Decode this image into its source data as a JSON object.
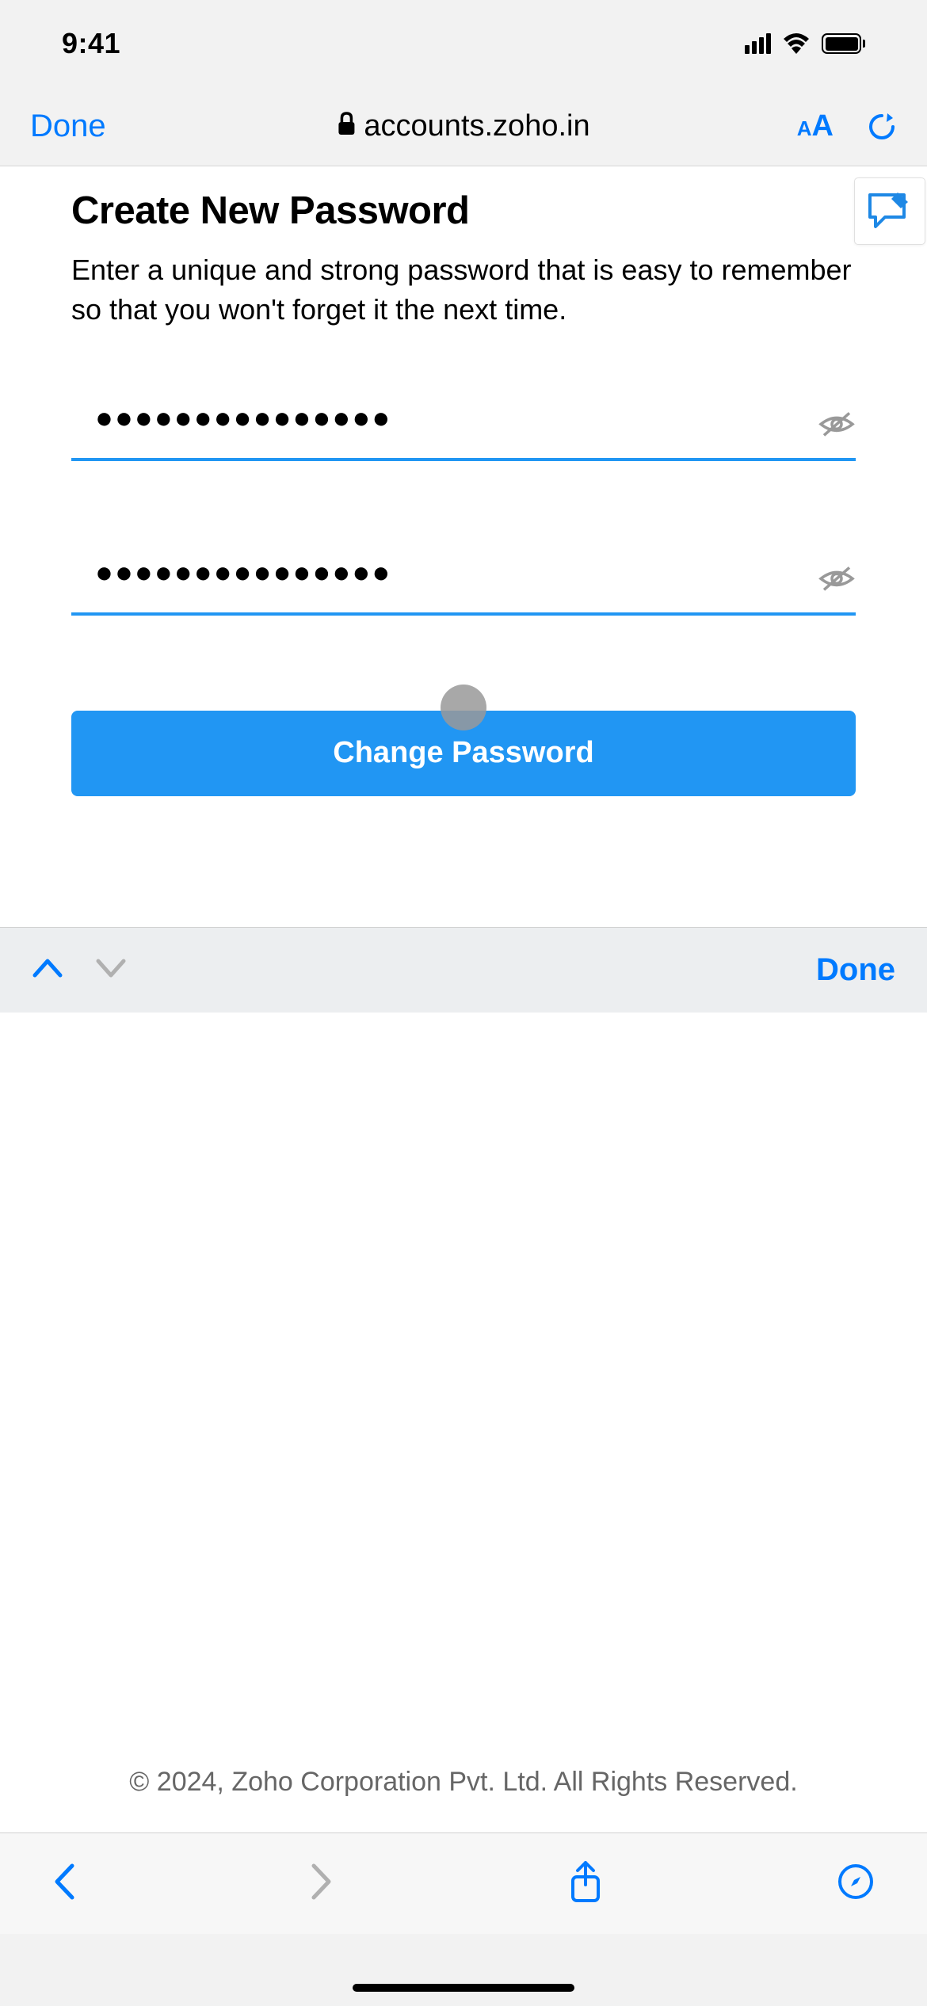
{
  "status": {
    "time": "9:41"
  },
  "browser": {
    "done_label": "Done",
    "url": "accounts.zoho.in"
  },
  "page": {
    "title": "Create New Password",
    "subtitle": "Enter a unique and strong password that is easy to remember so that you won't forget it the next time.",
    "password1_masked": "●●●●●●●●●●●●●●●",
    "password2_masked": "●●●●●●●●●●●●●●●",
    "submit_label": "Change Password"
  },
  "keyboard_accessory": {
    "done_label": "Done"
  },
  "footer": {
    "copyright": "© 2024, Zoho Corporation Pvt. Ltd. All Rights Reserved."
  }
}
